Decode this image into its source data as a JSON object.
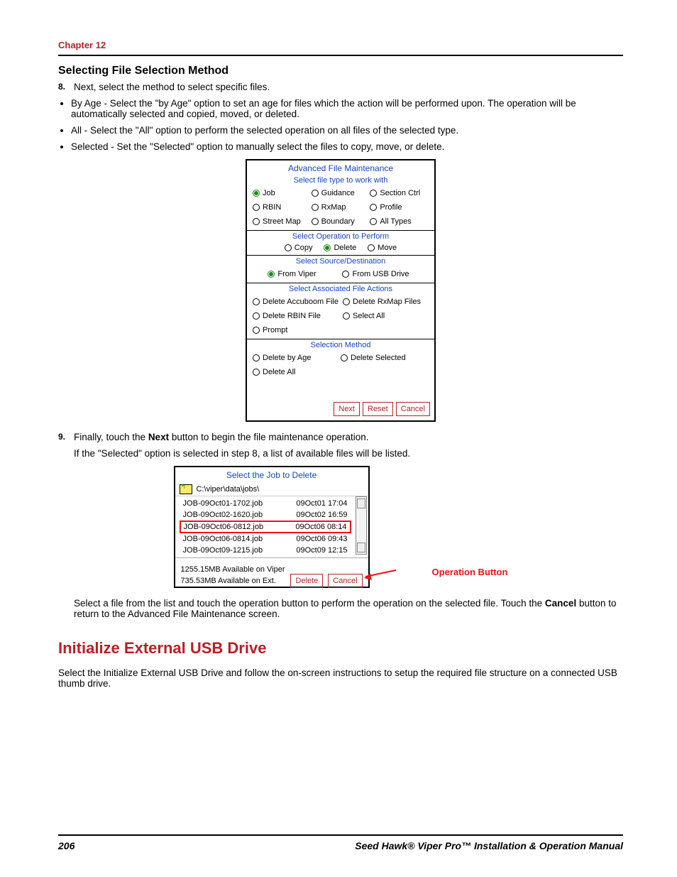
{
  "chapter": "Chapter 12",
  "heading_sub": "Selecting File Selection Method",
  "step8_num": "8.",
  "step8_text": "Next, select the method to select specific files.",
  "bullets": [
    "By Age - Select the \"by Age\" option to set an age for files which the action will be performed upon. The operation will be automatically selected and copied, moved, or deleted.",
    "All - Select the \"All\" option to perform the selected operation on all files of the selected type.",
    "Selected - Set the \"Selected\" option to manually select the files to copy, move, or delete."
  ],
  "dialog1": {
    "title": "Advanced File Maintenance",
    "sect1_title": "Select file type to work with",
    "filetypes": [
      "Job",
      "Guidance",
      "Section Ctrl",
      "RBIN",
      "RxMap",
      "Profile",
      "Street Map",
      "Boundary",
      "All Types"
    ],
    "sect2_title": "Select Operation to Perform",
    "ops": [
      "Copy",
      "Delete",
      "Move"
    ],
    "sect3_title": "Select Source/Destination",
    "src": [
      "From Viper",
      "From USB Drive"
    ],
    "sect4_title": "Select Associated File Actions",
    "assoc": [
      "Delete Accuboom File",
      "Delete RxMap Files",
      "Delete RBIN File",
      "Select All",
      "Prompt"
    ],
    "sect5_title": "Selection Method",
    "methods": [
      "Delete by Age",
      "Delete Selected",
      "Delete All"
    ],
    "btn_next": "Next",
    "btn_reset": "Reset",
    "btn_cancel": "Cancel"
  },
  "step9_num": "9.",
  "step9_text_1": "Finally, touch the ",
  "step9_text_b": "Next",
  "step9_text_2": " button to begin the file maintenance operation.",
  "step9_para": "If the \"Selected\" option is selected in step 8, a list of available files will be listed.",
  "dialog2": {
    "title": "Select the Job to Delete",
    "path": "C:\\viper\\data\\jobs\\",
    "files": [
      {
        "name": "JOB-09Oct01-1702.job",
        "ts": "09Oct01 17:04"
      },
      {
        "name": "JOB-09Oct02-1620.job",
        "ts": "09Oct02 16:59"
      },
      {
        "name": "JOB-09Oct06-0812.job",
        "ts": "09Oct06 08:14"
      },
      {
        "name": "JOB-09Oct06-0814.job",
        "ts": "09Oct06 09:43"
      },
      {
        "name": "JOB-09Oct09-1215.job",
        "ts": "09Oct09 12:15"
      }
    ],
    "avail1": "1255.15MB Available on Viper",
    "avail2": "735.53MB Available on Ext.",
    "btn_delete": "Delete",
    "btn_cancel": "Cancel"
  },
  "annot_label": "Operation Button",
  "after_para_1a": "Select a file from the list and touch the operation button to perform the operation on the selected file. Touch the ",
  "after_para_1b": "Cancel",
  "after_para_1c": " button to return to the Advanced File Maintenance screen.",
  "section2_title": "Initialize External USB Drive",
  "section2_para": "Select the Initialize External USB Drive and follow the on-screen instructions to setup the required file structure on a connected USB thumb drive.",
  "footer_page": "206",
  "footer_title": "Seed Hawk® Viper Pro™ Installation & Operation Manual"
}
